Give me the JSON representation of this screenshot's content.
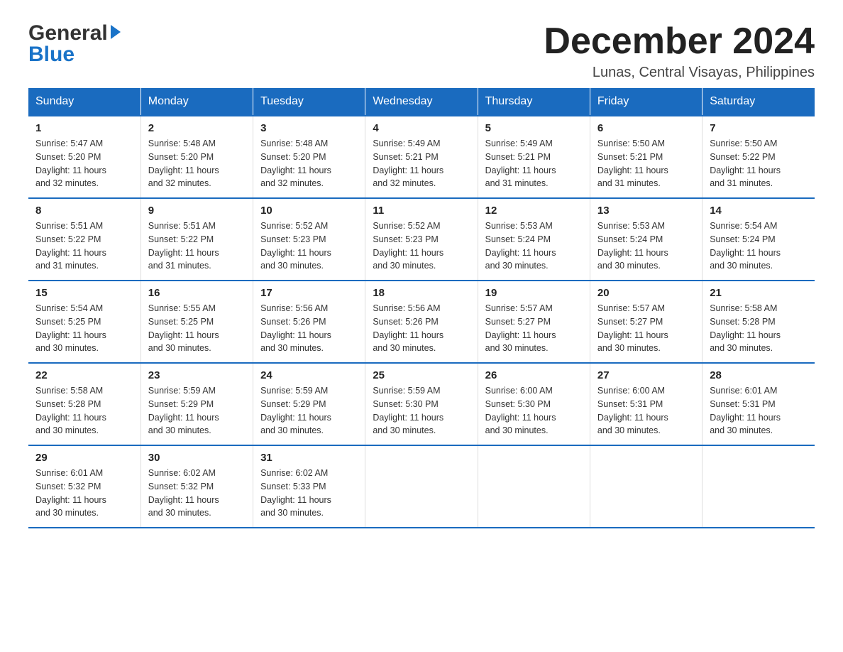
{
  "logo": {
    "general": "General",
    "blue": "Blue"
  },
  "header": {
    "month": "December 2024",
    "location": "Lunas, Central Visayas, Philippines"
  },
  "days_of_week": [
    "Sunday",
    "Monday",
    "Tuesday",
    "Wednesday",
    "Thursday",
    "Friday",
    "Saturday"
  ],
  "weeks": [
    [
      {
        "day": "1",
        "sunrise": "5:47 AM",
        "sunset": "5:20 PM",
        "daylight": "11 hours and 32 minutes."
      },
      {
        "day": "2",
        "sunrise": "5:48 AM",
        "sunset": "5:20 PM",
        "daylight": "11 hours and 32 minutes."
      },
      {
        "day": "3",
        "sunrise": "5:48 AM",
        "sunset": "5:20 PM",
        "daylight": "11 hours and 32 minutes."
      },
      {
        "day": "4",
        "sunrise": "5:49 AM",
        "sunset": "5:21 PM",
        "daylight": "11 hours and 32 minutes."
      },
      {
        "day": "5",
        "sunrise": "5:49 AM",
        "sunset": "5:21 PM",
        "daylight": "11 hours and 31 minutes."
      },
      {
        "day": "6",
        "sunrise": "5:50 AM",
        "sunset": "5:21 PM",
        "daylight": "11 hours and 31 minutes."
      },
      {
        "day": "7",
        "sunrise": "5:50 AM",
        "sunset": "5:22 PM",
        "daylight": "11 hours and 31 minutes."
      }
    ],
    [
      {
        "day": "8",
        "sunrise": "5:51 AM",
        "sunset": "5:22 PM",
        "daylight": "11 hours and 31 minutes."
      },
      {
        "day": "9",
        "sunrise": "5:51 AM",
        "sunset": "5:22 PM",
        "daylight": "11 hours and 31 minutes."
      },
      {
        "day": "10",
        "sunrise": "5:52 AM",
        "sunset": "5:23 PM",
        "daylight": "11 hours and 30 minutes."
      },
      {
        "day": "11",
        "sunrise": "5:52 AM",
        "sunset": "5:23 PM",
        "daylight": "11 hours and 30 minutes."
      },
      {
        "day": "12",
        "sunrise": "5:53 AM",
        "sunset": "5:24 PM",
        "daylight": "11 hours and 30 minutes."
      },
      {
        "day": "13",
        "sunrise": "5:53 AM",
        "sunset": "5:24 PM",
        "daylight": "11 hours and 30 minutes."
      },
      {
        "day": "14",
        "sunrise": "5:54 AM",
        "sunset": "5:24 PM",
        "daylight": "11 hours and 30 minutes."
      }
    ],
    [
      {
        "day": "15",
        "sunrise": "5:54 AM",
        "sunset": "5:25 PM",
        "daylight": "11 hours and 30 minutes."
      },
      {
        "day": "16",
        "sunrise": "5:55 AM",
        "sunset": "5:25 PM",
        "daylight": "11 hours and 30 minutes."
      },
      {
        "day": "17",
        "sunrise": "5:56 AM",
        "sunset": "5:26 PM",
        "daylight": "11 hours and 30 minutes."
      },
      {
        "day": "18",
        "sunrise": "5:56 AM",
        "sunset": "5:26 PM",
        "daylight": "11 hours and 30 minutes."
      },
      {
        "day": "19",
        "sunrise": "5:57 AM",
        "sunset": "5:27 PM",
        "daylight": "11 hours and 30 minutes."
      },
      {
        "day": "20",
        "sunrise": "5:57 AM",
        "sunset": "5:27 PM",
        "daylight": "11 hours and 30 minutes."
      },
      {
        "day": "21",
        "sunrise": "5:58 AM",
        "sunset": "5:28 PM",
        "daylight": "11 hours and 30 minutes."
      }
    ],
    [
      {
        "day": "22",
        "sunrise": "5:58 AM",
        "sunset": "5:28 PM",
        "daylight": "11 hours and 30 minutes."
      },
      {
        "day": "23",
        "sunrise": "5:59 AM",
        "sunset": "5:29 PM",
        "daylight": "11 hours and 30 minutes."
      },
      {
        "day": "24",
        "sunrise": "5:59 AM",
        "sunset": "5:29 PM",
        "daylight": "11 hours and 30 minutes."
      },
      {
        "day": "25",
        "sunrise": "5:59 AM",
        "sunset": "5:30 PM",
        "daylight": "11 hours and 30 minutes."
      },
      {
        "day": "26",
        "sunrise": "6:00 AM",
        "sunset": "5:30 PM",
        "daylight": "11 hours and 30 minutes."
      },
      {
        "day": "27",
        "sunrise": "6:00 AM",
        "sunset": "5:31 PM",
        "daylight": "11 hours and 30 minutes."
      },
      {
        "day": "28",
        "sunrise": "6:01 AM",
        "sunset": "5:31 PM",
        "daylight": "11 hours and 30 minutes."
      }
    ],
    [
      {
        "day": "29",
        "sunrise": "6:01 AM",
        "sunset": "5:32 PM",
        "daylight": "11 hours and 30 minutes."
      },
      {
        "day": "30",
        "sunrise": "6:02 AM",
        "sunset": "5:32 PM",
        "daylight": "11 hours and 30 minutes."
      },
      {
        "day": "31",
        "sunrise": "6:02 AM",
        "sunset": "5:33 PM",
        "daylight": "11 hours and 30 minutes."
      },
      null,
      null,
      null,
      null
    ]
  ],
  "labels": {
    "sunrise": "Sunrise:",
    "sunset": "Sunset:",
    "daylight": "Daylight:"
  }
}
